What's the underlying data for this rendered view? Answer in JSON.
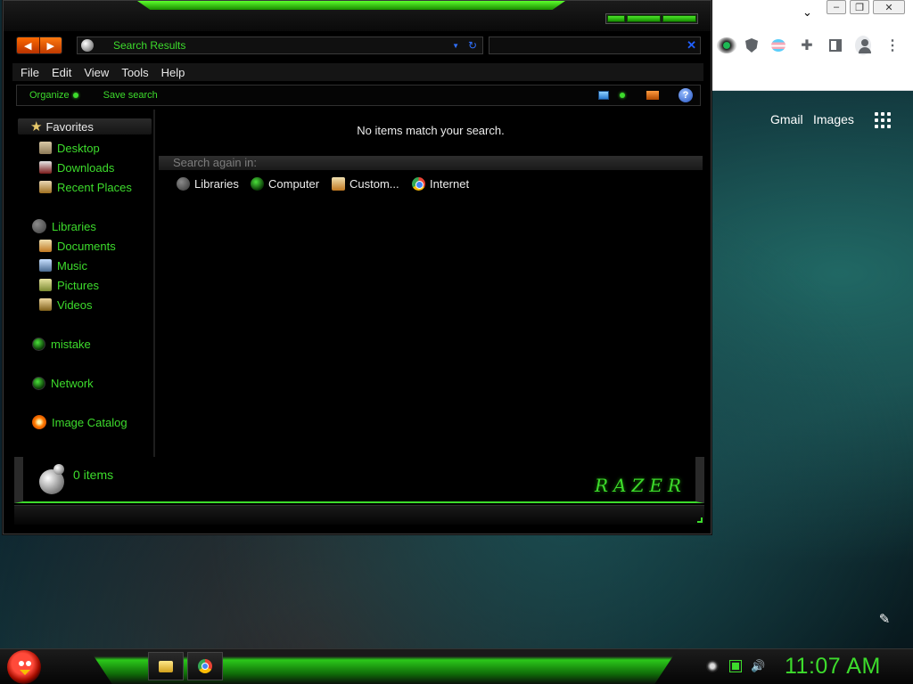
{
  "browser": {
    "top_links": {
      "gmail": "Gmail",
      "images": "Images"
    }
  },
  "explorer": {
    "address": "Search Results",
    "menu": [
      "File",
      "Edit",
      "View",
      "Tools",
      "Help"
    ],
    "commands": {
      "organize": "Organize",
      "save_search": "Save search"
    },
    "nav": {
      "favorites_header": "Favorites",
      "favorites": [
        "Desktop",
        "Downloads",
        "Recent Places"
      ],
      "libraries_header": "Libraries",
      "libraries": [
        "Documents",
        "Music",
        "Pictures",
        "Videos"
      ],
      "other": [
        "mistake",
        "Network",
        "Image Catalog"
      ]
    },
    "content": {
      "message": "No items match your search.",
      "search_again": "Search again in:",
      "locations": [
        "Libraries",
        "Computer",
        "Custom...",
        "Internet"
      ]
    },
    "details": {
      "item_count": "0 items",
      "brand": "RAZER"
    }
  },
  "taskbar": {
    "clock": "11:07 AM"
  },
  "colors": {
    "accent_green": "#3ddc2c",
    "window_bg": "#000000",
    "back_forward": "#ff6a00"
  },
  "icons": [
    "back-arrow-icon",
    "forward-arrow-icon",
    "search-results-icon",
    "refresh-icon",
    "search-clear-icon",
    "favorites-star-icon",
    "help-icon",
    "start-orb-icon",
    "folder-icon",
    "chrome-icon",
    "volume-icon",
    "network-tray-icon",
    "apps-grid-icon",
    "pencil-icon"
  ]
}
